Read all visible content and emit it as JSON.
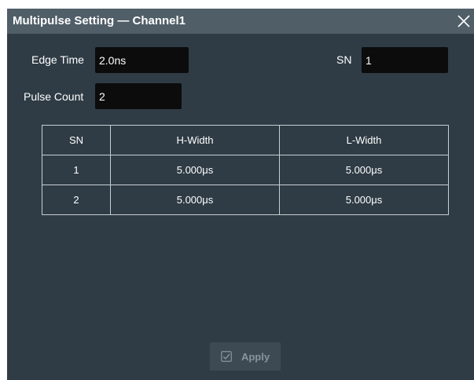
{
  "dialog": {
    "title": "Multipulse Setting — Channel1",
    "close_icon": "close-icon"
  },
  "settings": {
    "edge_time_label": "Edge Time",
    "edge_time_value": "2.0ns",
    "sn_label": "SN",
    "sn_value": "1",
    "pulse_count_label": "Pulse Count",
    "pulse_count_value": "2"
  },
  "table": {
    "headers": [
      "SN",
      "H-Width",
      "L-Width"
    ],
    "rows": [
      [
        "1",
        "5.000μs",
        "5.000μs"
      ],
      [
        "2",
        "5.000μs",
        "5.000μs"
      ]
    ]
  },
  "apply_button": {
    "label": "Apply",
    "icon": "checkbox-checked-icon"
  },
  "colors": {
    "dialog_bg": "#2f3c45",
    "titlebar_bg": "#505e68",
    "field_bg": "#0c0c0c",
    "table_border": "#c8ced2"
  }
}
